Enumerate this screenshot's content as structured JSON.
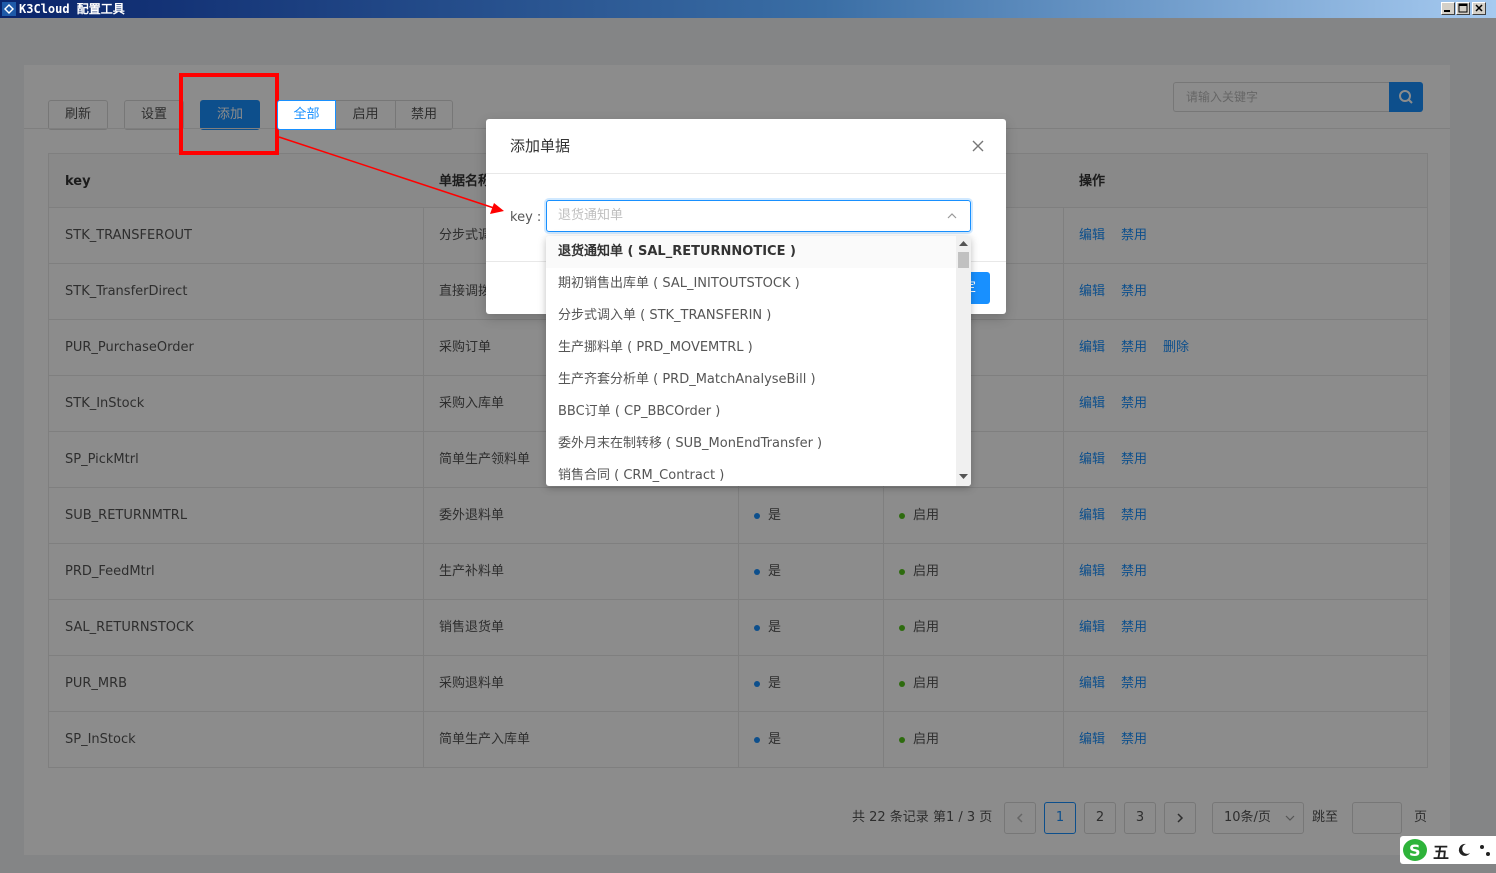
{
  "window": {
    "title": "K3Cloud 配置工具"
  },
  "toolbar": {
    "refresh": "刷新",
    "settings": "设置",
    "add": "添加",
    "filters": [
      "全部",
      "启用",
      "禁用"
    ],
    "search_placeholder": "请输入关键字"
  },
  "table": {
    "columns": [
      "key",
      "单据名称",
      "",
      "",
      "操作"
    ],
    "rows": [
      {
        "key": "STK_TRANSFEROUT",
        "name": "分步式调出单",
        "c3": "",
        "c4": "",
        "actions": [
          "编辑",
          "禁用"
        ]
      },
      {
        "key": "STK_TransferDirect",
        "name": "直接调拨单",
        "c3": "",
        "c4": "",
        "actions": [
          "编辑",
          "禁用"
        ]
      },
      {
        "key": "PUR_PurchaseOrder",
        "name": "采购订单",
        "c3": "",
        "c4": "",
        "actions": [
          "编辑",
          "禁用",
          "删除"
        ]
      },
      {
        "key": "STK_InStock",
        "name": "采购入库单",
        "c3": "",
        "c4": "",
        "actions": [
          "编辑",
          "禁用"
        ]
      },
      {
        "key": "SP_PickMtrl",
        "name": "简单生产领料单",
        "c3": "",
        "c4": "",
        "actions": [
          "编辑",
          "禁用"
        ]
      },
      {
        "key": "SUB_RETURNMTRL",
        "name": "委外退料单",
        "c3": "是",
        "c4": "启用",
        "actions": [
          "编辑",
          "禁用"
        ]
      },
      {
        "key": "PRD_FeedMtrl",
        "name": "生产补料单",
        "c3": "是",
        "c4": "启用",
        "actions": [
          "编辑",
          "禁用"
        ]
      },
      {
        "key": "SAL_RETURNSTOCK",
        "name": "销售退货单",
        "c3": "是",
        "c4": "启用",
        "actions": [
          "编辑",
          "禁用"
        ]
      },
      {
        "key": "PUR_MRB",
        "name": "采购退料单",
        "c3": "是",
        "c4": "启用",
        "actions": [
          "编辑",
          "禁用"
        ]
      },
      {
        "key": "SP_InStock",
        "name": "简单生产入库单",
        "c3": "是",
        "c4": "启用",
        "actions": [
          "编辑",
          "禁用"
        ]
      }
    ]
  },
  "pagination": {
    "total_text": "共 22 条记录 第1 / 3 页",
    "pages": [
      "1",
      "2",
      "3"
    ],
    "current": "1",
    "page_size": "10条/页",
    "goto_label": "跳至",
    "page_suffix": "页"
  },
  "modal": {
    "title": "添加单据",
    "key_label": "key :",
    "key_placeholder": "退货通知单",
    "ok_label": "确定",
    "options": [
      "退货通知单 ( SAL_RETURNNOTICE )",
      "期初销售出库单 ( SAL_INITOUTSTOCK )",
      "分步式调入单 ( STK_TRANSFERIN )",
      "生产挪料单 ( PRD_MOVEMTRL )",
      "生产齐套分析单 ( PRD_MatchAnalyseBill )",
      "BBC订单 ( CP_BBCOrder )",
      "委外月末在制转移 ( SUB_MonEndTransfer )",
      "销售合同 ( CRM_Contract )"
    ]
  },
  "ime": {
    "label": "五"
  },
  "colors": {
    "primary": "#1890ff",
    "annotation": "#ff0000",
    "status_dot_blue": "#1890ff",
    "status_dot_green": "#52c41a"
  },
  "icons": [
    "app-icon",
    "minimize-icon",
    "maximize-icon",
    "close-icon",
    "search-icon",
    "chevron-up-icon",
    "chevron-left-icon",
    "chevron-right-icon",
    "chevron-down-icon"
  ]
}
